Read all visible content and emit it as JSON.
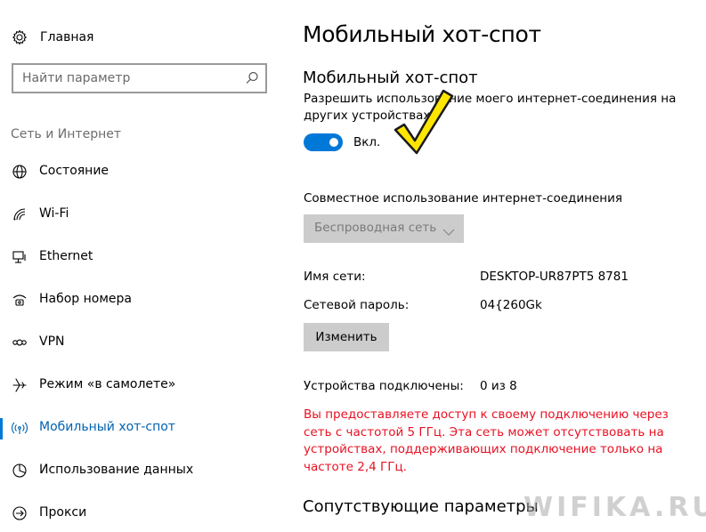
{
  "sidebar": {
    "home_label": "Главная",
    "search_placeholder": "Найти параметр",
    "section_title": "Сеть и Интернет",
    "items": [
      {
        "label": "Состояние",
        "icon": "globe-icon"
      },
      {
        "label": "Wi-Fi",
        "icon": "wifi-icon"
      },
      {
        "label": "Ethernet",
        "icon": "ethernet-icon"
      },
      {
        "label": "Набор номера",
        "icon": "dialup-icon"
      },
      {
        "label": "VPN",
        "icon": "vpn-icon"
      },
      {
        "label": "Режим «в самолете»",
        "icon": "airplane-icon"
      },
      {
        "label": "Мобильный хот-спот",
        "icon": "hotspot-icon"
      },
      {
        "label": "Использование данных",
        "icon": "data-usage-icon"
      },
      {
        "label": "Прокси",
        "icon": "proxy-icon"
      }
    ],
    "active_index": 6
  },
  "main": {
    "title": "Мобильный хот-спот",
    "subtitle": "Мобильный хот-спот",
    "share_description": "Разрешить использование моего интернет-соединения на других устройствах",
    "toggle_state": "Вкл.",
    "toggle_on": true,
    "share_from_label": "Совместное использование интернет-соединения",
    "share_from_value": "Беспроводная сеть",
    "network_name_label": "Имя сети:",
    "network_name_value": "DESKTOP-UR87PT5 8781",
    "password_label": "Сетевой пароль:",
    "password_value": "04{260Gk",
    "edit_button": "Изменить",
    "devices_label": "Устройства подключены:",
    "devices_value": "0 из 8",
    "warning": "Вы предоставляете доступ к своему подключению через сеть с частотой 5 ГГц. Эта сеть может отсутствовать на устройствах, поддерживающих подключение только на частоте 2,4 ГГц.",
    "related_title": "Сопутствующие параметры"
  },
  "watermark": "WIFIKA.RU",
  "colors": {
    "accent": "#0078d7",
    "active_text": "#0063b1",
    "warning": "#e81123",
    "button_bg": "#cccccc",
    "checkmark": "#ffe600"
  }
}
